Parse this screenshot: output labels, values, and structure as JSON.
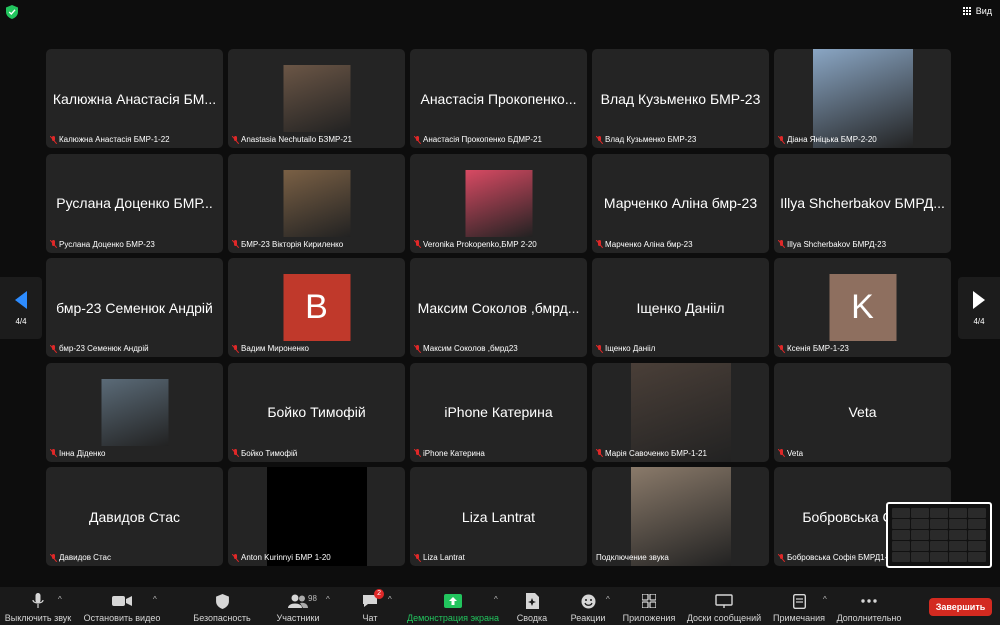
{
  "view_label": "Вид",
  "pager": {
    "left": "4/4",
    "right": "4/4"
  },
  "tiles": [
    {
      "big": "Калюжна Анастасія БМ...",
      "label": "Калюжна Анастасія БМР-1-22",
      "type": "name"
    },
    {
      "big": "",
      "label": "Anastasia Nechutailo БЗМР-21",
      "type": "video",
      "color": "#6b5646"
    },
    {
      "big": "Анастасія Прокопенко...",
      "label": "Анастасія Прокопенко БДМР-21",
      "type": "name"
    },
    {
      "big": "Влад Кузьменко БМР-23",
      "label": "Влад Кузьменко БМР-23",
      "type": "name"
    },
    {
      "big": "",
      "label": "Діана Яніцька БМР-2-20",
      "type": "video",
      "color": "#8aa6c4"
    },
    {
      "big": "Руслана Доценко БМР...",
      "label": "Руслана Доценко БМР-23",
      "type": "name"
    },
    {
      "big": "",
      "label": "БМР-23 Вікторія Кириленко",
      "type": "video",
      "color": "#7a6045"
    },
    {
      "big": "",
      "label": "Veronika Prokopenko,БМР 2-20",
      "type": "video",
      "color": "#d84a63"
    },
    {
      "big": "Марченко Аліна бмр-23",
      "label": "Марченко Аліна бмр-23",
      "type": "name"
    },
    {
      "big": "Illya Shcherbakov БМРД...",
      "label": "Illya Shcherbakov БМРД-23",
      "type": "name"
    },
    {
      "big": "бмр-23 Семенюк Андрій",
      "label": "бмр-23 Семенюк Андрій",
      "type": "name"
    },
    {
      "big": "",
      "label": "Вадим Мироненко",
      "type": "avatar",
      "letter": "В",
      "color": "#c0392b"
    },
    {
      "big": "Максим Соколов ,бмрд...",
      "label": "Максим Соколов ,бмрд23",
      "type": "name"
    },
    {
      "big": "Іщенко Данііл",
      "label": "Іщенко Данііл",
      "type": "name"
    },
    {
      "big": "",
      "label": "Ксенія БМР-1-23",
      "type": "avatar",
      "letter": "K",
      "color": "#8e6f5f"
    },
    {
      "big": "",
      "label": "Інна Діденко",
      "type": "video",
      "color": "#5b6b78"
    },
    {
      "big": "Бойко Тимофій",
      "label": "Бойко Тимофій",
      "type": "name"
    },
    {
      "big": "iPhone Катерина",
      "label": "iPhone Катерина",
      "type": "name"
    },
    {
      "big": "",
      "label": "Марія Савоченко БМР-1-21",
      "type": "video",
      "color": "#4a3f38"
    },
    {
      "big": "Veta",
      "label": "Veta",
      "type": "name"
    },
    {
      "big": "Давидов Стас",
      "label": "Давидов Стас",
      "type": "name"
    },
    {
      "big": "",
      "label": "Anton Kurinnyi БМР 1-20",
      "type": "black"
    },
    {
      "big": "Liza Lantrat",
      "label": "Liza Lantrat",
      "type": "name"
    },
    {
      "big": "",
      "label": "Подключение звука",
      "type": "video",
      "color": "#8a7a6a",
      "nomic": true
    },
    {
      "big": "Бобровська Софія",
      "label": "Бобровська Софія БМРД1-...",
      "type": "name"
    }
  ],
  "toolbar": {
    "mute": "Выключить звук",
    "video": "Остановить видео",
    "security": "Безопасность",
    "participants": "Участники",
    "participants_count": "98",
    "chat": "Чат",
    "chat_badge": "2",
    "share": "Демонстрация экрана",
    "summary": "Сводка",
    "reactions": "Реакции",
    "apps": "Приложения",
    "whiteboards": "Доски сообщений",
    "notes": "Примечания",
    "more": "Дополнительно",
    "end": "Завершить"
  },
  "colors": {
    "accent": "#2d8cff",
    "end": "#d32a20",
    "share": "#22c55e",
    "tile": "#242424"
  }
}
